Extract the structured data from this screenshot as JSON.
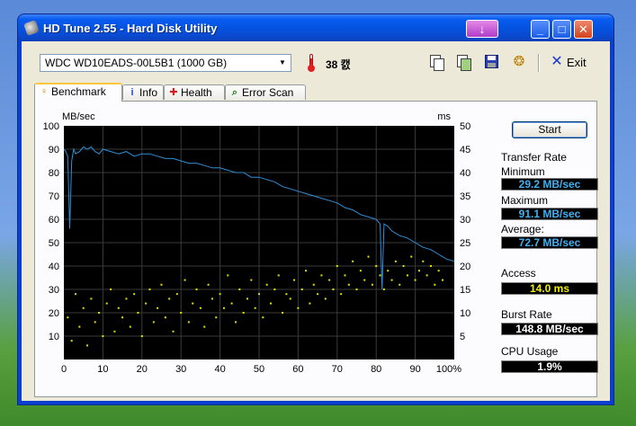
{
  "window": {
    "title": "HD Tune 2.55 - Hard Disk Utility"
  },
  "titlebar_buttons": {
    "minimize": "_",
    "maximize": "□",
    "close": "✕",
    "update": "↓"
  },
  "toolbar": {
    "drive": "WDC WD10EADS-00L5B1 (1000 GB)",
    "temperature": "38 캜",
    "exit_label": "Exit",
    "icons": [
      "copy-icon",
      "paste-icon",
      "save-icon",
      "options-icon",
      "exit-icon"
    ]
  },
  "tabs": [
    {
      "label": "Benchmark",
      "icon": "benchmark-icon",
      "active": true
    },
    {
      "label": "Info",
      "icon": "info-icon",
      "active": false
    },
    {
      "label": "Health",
      "icon": "health-icon",
      "active": false
    },
    {
      "label": "Error Scan",
      "icon": "error-scan-icon",
      "active": false
    }
  ],
  "controls": {
    "start_label": "Start"
  },
  "stats": {
    "transfer_rate_label": "Transfer Rate",
    "minimum_label": "Minimum",
    "minimum_value": "29.2 MB/sec",
    "maximum_label": "Maximum",
    "maximum_value": "91.1 MB/sec",
    "average_label": "Average:",
    "average_value": "72.7 MB/sec",
    "access_label": "Access",
    "access_value": "14.0 ms",
    "burst_label": "Burst Rate",
    "burst_value": "148.8 MB/sec",
    "cpu_label": "CPU Usage",
    "cpu_value": "1.9%"
  },
  "colors": {
    "plot_background": "#000000",
    "grid": "#3a3a3a",
    "transfer_line": "#2f8fd8",
    "access_dots": "#e0e000"
  },
  "chart_data": {
    "type": "line",
    "ylabel": "MB/sec",
    "y2label": "ms",
    "xlim": [
      0,
      100
    ],
    "ylim": [
      0,
      100
    ],
    "y2lim": [
      0,
      50
    ],
    "x_ticks": [
      "0",
      "10",
      "20",
      "30",
      "40",
      "50",
      "60",
      "70",
      "80",
      "90",
      "100%"
    ],
    "y_ticks": [
      "10",
      "20",
      "30",
      "40",
      "50",
      "60",
      "70",
      "80",
      "90",
      "100"
    ],
    "y2_ticks": [
      "5",
      "10",
      "15",
      "20",
      "25",
      "30",
      "35",
      "40",
      "45",
      "50"
    ],
    "grid": true,
    "series": [
      {
        "type": "line",
        "axis": "left",
        "x": [
          0,
          0.5,
          1,
          1.5,
          2,
          2.5,
          3,
          4,
          5,
          6,
          7,
          8,
          9,
          10,
          12,
          14,
          16,
          18,
          20,
          22,
          24,
          26,
          28,
          30,
          32,
          34,
          36,
          38,
          40,
          42,
          44,
          46,
          48,
          50,
          52,
          54,
          56,
          58,
          60,
          62,
          64,
          66,
          68,
          70,
          72,
          74,
          76,
          78,
          80,
          81,
          81.5,
          82,
          83,
          84,
          86,
          88,
          90,
          92,
          94,
          96,
          98,
          100
        ],
        "values": [
          90,
          89,
          87,
          56,
          85,
          90,
          88,
          89,
          91,
          90,
          91,
          89,
          88,
          90,
          89,
          88,
          89,
          87,
          88,
          88,
          87,
          86,
          86,
          85,
          84,
          84,
          83,
          82,
          82,
          81,
          80,
          80,
          78,
          78,
          77,
          76,
          74,
          73,
          72,
          71,
          70,
          69,
          68,
          67,
          65,
          64,
          62,
          61,
          60,
          58,
          30,
          58,
          57,
          55,
          53,
          52,
          50,
          48,
          47,
          45,
          43,
          42
        ]
      },
      {
        "type": "scatter",
        "axis": "right",
        "x": [
          1,
          2,
          3,
          4,
          5,
          6,
          7,
          8,
          9,
          10,
          11,
          12,
          13,
          14,
          15,
          16,
          17,
          18,
          19,
          20,
          21,
          22,
          23,
          24,
          25,
          26,
          27,
          28,
          29,
          30,
          31,
          32,
          33,
          34,
          35,
          36,
          37,
          38,
          39,
          40,
          41,
          42,
          43,
          44,
          45,
          46,
          47,
          48,
          49,
          50,
          51,
          52,
          53,
          54,
          55,
          56,
          57,
          58,
          59,
          60,
          61,
          62,
          63,
          64,
          65,
          66,
          67,
          68,
          69,
          70,
          71,
          72,
          73,
          74,
          75,
          76,
          77,
          78,
          79,
          80,
          81,
          82,
          83,
          84,
          85,
          86,
          87,
          88,
          89,
          90,
          91,
          92,
          93,
          94,
          95,
          96,
          97
        ],
        "values": [
          9,
          4,
          14,
          7,
          11,
          3,
          13,
          8,
          10,
          5,
          12,
          15,
          6,
          11,
          9,
          13,
          7,
          14,
          10,
          5,
          12,
          15,
          8,
          11,
          16,
          9,
          13,
          6,
          14,
          10,
          17,
          8,
          12,
          15,
          11,
          7,
          16,
          13,
          9,
          14,
          11,
          18,
          12,
          8,
          15,
          10,
          13,
          17,
          11,
          14,
          9,
          16,
          12,
          15,
          18,
          10,
          14,
          13,
          17,
          11,
          15,
          19,
          12,
          16,
          14,
          18,
          13,
          17,
          15,
          20,
          14,
          18,
          16,
          21,
          15,
          19,
          17,
          22,
          16,
          20,
          18,
          15,
          19,
          17,
          21,
          16,
          20,
          18,
          22,
          17,
          19,
          21,
          18,
          20,
          16,
          19,
          17
        ]
      }
    ]
  }
}
